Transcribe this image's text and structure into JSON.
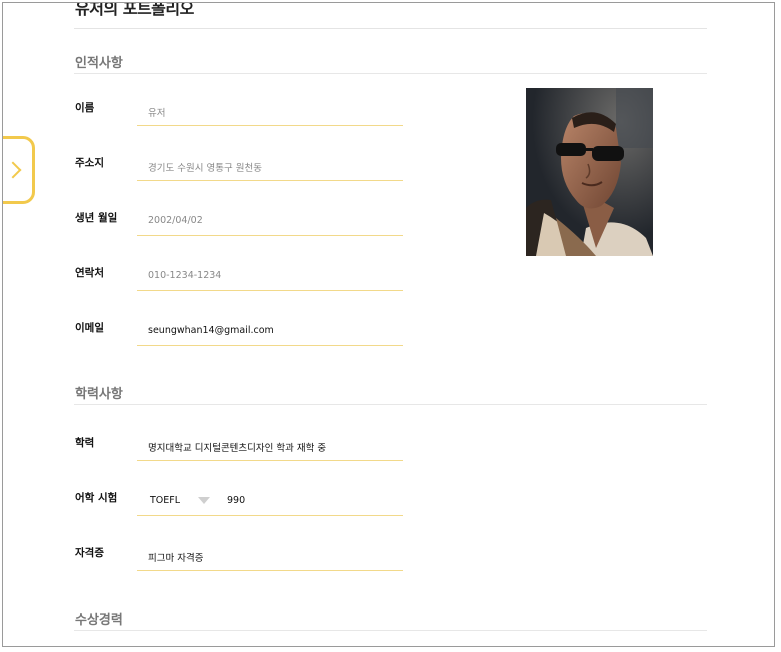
{
  "page": {
    "title": "유저의 포트폴리오"
  },
  "sections": {
    "personal": "인적사항",
    "education": "학력사항",
    "awards": "수상경력"
  },
  "personal": {
    "name_label": "이름",
    "name_value": "유저",
    "address_label": "주소지",
    "address_value": "경기도 수원시 영통구 원천동",
    "birth_label": "생년 월일",
    "birth_value": "2002/04/02",
    "contact_label": "연락처",
    "contact_value": "010-1234-1234",
    "email_label": "이메일",
    "email_value": "seungwhan14@gmail.com"
  },
  "education": {
    "school_label": "학력",
    "school_value": "명지대학교 디지털콘텐츠디자인 학과 재학 중",
    "language_label": "어학 시험",
    "language_test_selected": "TOEFL",
    "language_score": "990",
    "cert_label": "자격증",
    "cert_value": "피그마 자격증"
  },
  "icons": {
    "side_tab": "chevron-right-icon",
    "dropdown": "caret-down-icon"
  },
  "colors": {
    "accent": "#f2c94c",
    "field_underline": "#f2d98a",
    "section_text": "#777777"
  }
}
